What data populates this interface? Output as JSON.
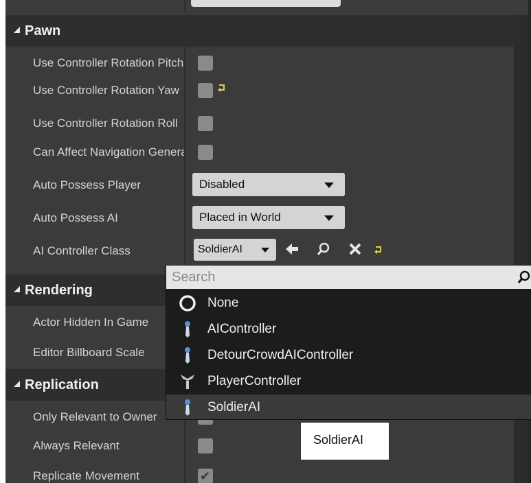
{
  "sections": {
    "pawn": {
      "title": "Pawn",
      "rows": [
        {
          "label": "Use Controller Rotation Pitch",
          "checked": false
        },
        {
          "label": "Use Controller Rotation Yaw",
          "checked": false
        },
        {
          "label": "Use Controller Rotation Roll",
          "checked": false
        },
        {
          "label": "Can Affect Navigation Generation",
          "checked": false
        }
      ],
      "auto_possess_player": {
        "label": "Auto Possess Player",
        "value": "Disabled"
      },
      "auto_possess_ai": {
        "label": "Auto Possess AI",
        "value": "Placed in World"
      },
      "ai_controller_class": {
        "label": "AI Controller Class",
        "value": "SoldierAI"
      }
    },
    "rendering": {
      "title": "Rendering",
      "rows": [
        {
          "label": "Actor Hidden In Game"
        },
        {
          "label": "Editor Billboard Scale"
        }
      ]
    },
    "replication": {
      "title": "Replication",
      "rows": [
        {
          "label": "Only Relevant to Owner",
          "checked": false
        },
        {
          "label": "Always Relevant",
          "checked": false
        },
        {
          "label": "Replicate Movement",
          "checked": true
        }
      ]
    }
  },
  "class_picker": {
    "search_placeholder": "Search",
    "options": [
      {
        "label": "None",
        "icon": "none-circle-icon"
      },
      {
        "label": "AIController",
        "icon": "ai-controller-icon"
      },
      {
        "label": "DetourCrowdAIController",
        "icon": "ai-controller-icon"
      },
      {
        "label": "PlayerController",
        "icon": "player-controller-icon"
      },
      {
        "label": "SoldierAI",
        "icon": "ai-controller-icon",
        "selected": true
      }
    ]
  },
  "tooltip": {
    "text": "SoldierAI"
  },
  "colors": {
    "panel_bg": "#3b3b3b",
    "header_bg": "#2e2e2e",
    "reset_arrow": "#e6d14a",
    "popup_bg": "#1c1c1c"
  }
}
